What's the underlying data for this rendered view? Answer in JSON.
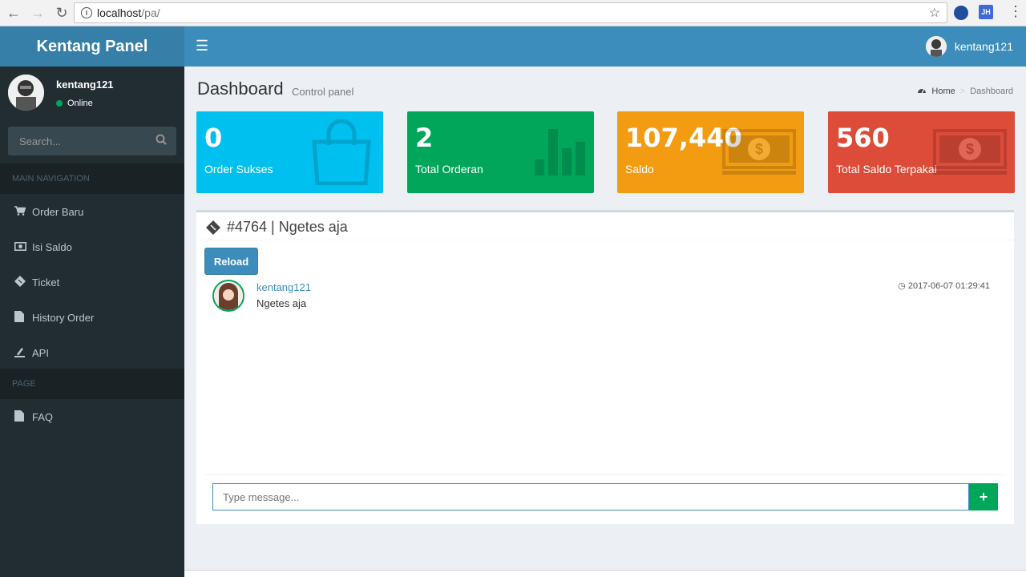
{
  "browser": {
    "url_host": "localhost",
    "url_path": "/pa/",
    "ext_label": "JH"
  },
  "header": {
    "logo": "Kentang Panel",
    "username": "kentang121"
  },
  "sidebar": {
    "username": "kentang121",
    "status": "Online",
    "search_placeholder": "Search...",
    "main_nav_header": "MAIN NAVIGATION",
    "items": [
      {
        "label": "Order Baru",
        "icon": "cart-icon"
      },
      {
        "label": "Isi Saldo",
        "icon": "money-icon"
      },
      {
        "label": "Ticket",
        "icon": "ticket-icon"
      },
      {
        "label": "History Order",
        "icon": "file-icon"
      },
      {
        "label": "API",
        "icon": "api-icon"
      }
    ],
    "page_header": "PAGE",
    "page_items": [
      {
        "label": "FAQ",
        "icon": "file-icon"
      }
    ]
  },
  "content": {
    "title": "Dashboard",
    "subtitle": "Control panel",
    "breadcrumb_home": "Home",
    "breadcrumb_current": "Dashboard"
  },
  "stats": [
    {
      "value": "0",
      "label": "Order Sukses",
      "color": "#00c0ef",
      "icon": "shopping-bag-icon"
    },
    {
      "value": "2",
      "label": "Total Orderan",
      "color": "#00a65a",
      "icon": "bar-chart-icon"
    },
    {
      "value": "107,440",
      "label": "Saldo",
      "color": "#f39c12",
      "icon": "money-icon"
    },
    {
      "value": "560",
      "label": "Total Saldo Terpakai",
      "color": "#dd4b39",
      "icon": "money-icon"
    }
  ],
  "ticket": {
    "title": "#4764 | Ngetes aja",
    "reload_label": "Reload",
    "message": {
      "user": "kentang121",
      "text": "Ngetes aja",
      "time": "2017-06-07 01:29:41"
    },
    "input_placeholder": "Type message...",
    "send_label": "+"
  }
}
